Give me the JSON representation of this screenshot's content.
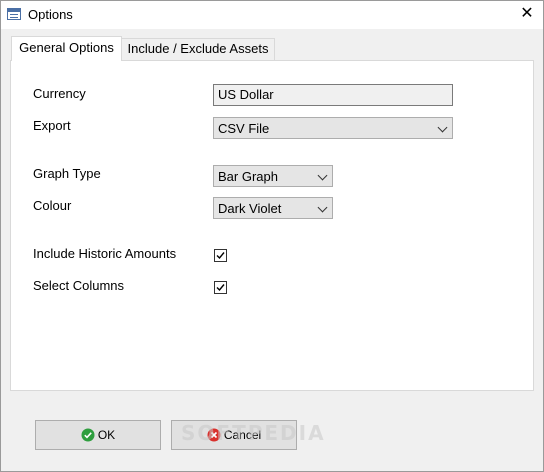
{
  "window": {
    "title": "Options",
    "close_glyph": "✕"
  },
  "tabs": [
    {
      "label": "General Options",
      "active": true
    },
    {
      "label": "Include / Exclude Assets",
      "active": false
    }
  ],
  "form": {
    "currency_label": "Currency",
    "currency_value": "US Dollar",
    "export_label": "Export",
    "export_value": "CSV File",
    "graph_type_label": "Graph Type",
    "graph_type_value": "Bar Graph",
    "colour_label": "Colour",
    "colour_value": "Dark Violet",
    "historic_label": "Include Historic Amounts",
    "historic_checked": true,
    "columns_label": "Select Columns",
    "columns_checked": true
  },
  "buttons": {
    "ok_label": "OK",
    "cancel_label": "Cancel"
  },
  "watermark": "SOFTPEDIA",
  "colors": {
    "ok_icon": "#2e9e3e",
    "cancel_icon": "#d9302c",
    "panel": "#ffffff",
    "chrome": "#f0f0f0"
  }
}
